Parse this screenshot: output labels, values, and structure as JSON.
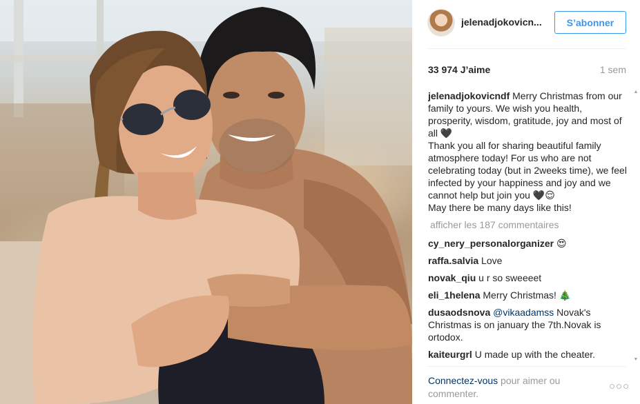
{
  "header": {
    "username": "jelenadjokovicn...",
    "follow_label": "S’abonner"
  },
  "stats": {
    "likes": "33 974 J’aime",
    "time": "1 sem"
  },
  "caption": {
    "user": "jelenadjokovicndf",
    "text": " Merry Christmas from our family to yours. We wish you health, prosperity, wisdom, gratitude, joy and most of all 🖤\nThank you all for sharing beautiful family atmosphere today! For us who are not celebrating today (but in 2weeks time), we feel infected by your happiness and joy and we cannot help but join you 🖤😌\nMay there be many days like this!"
  },
  "load_more": "afficher les 187 commentaires",
  "comments": [
    {
      "user": "cy_nery_personalorganizer",
      "text": " 😍"
    },
    {
      "user": "raffa.salvia",
      "text": " Love"
    },
    {
      "user": "novak_qiu",
      "text": " u r so sweeeet"
    },
    {
      "user": "eli_1helena",
      "text": " Merry Christmas! 🎄"
    },
    {
      "user": "dusaodsnova",
      "mention": " @vikaadamss",
      "text": " Novak's Christmas is on january the 7th.Novak is ortodox."
    },
    {
      "user": "kaiteurgrl",
      "text": " U made up with the cheater."
    }
  ],
  "footer": {
    "login_link": "Connectez-vous",
    "login_rest": " pour aimer ou commenter."
  },
  "icons": {
    "more": "more-options-icon",
    "scroll_up": "scroll-up-icon",
    "scroll_down": "scroll-down-icon"
  },
  "colors": {
    "accent": "#3897f0",
    "link": "#003569",
    "muted": "#999999"
  }
}
